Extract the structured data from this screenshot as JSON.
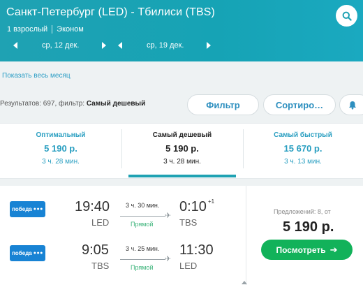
{
  "header": {
    "title": "Санкт-Петербург (LED) - Тбилиси (TBS)",
    "passengers": "1 взрослый",
    "cabin": "Эконом",
    "search_icon": "search-icon",
    "outbound_date": "ср, 12 дек.",
    "return_date": "ср, 19 дек.",
    "colors": {
      "accent": "#1fa2b3"
    }
  },
  "month_link": "Показать весь месяц",
  "results": {
    "prefix": "Результатов: 697, фильтр:",
    "filter": "Самый дешевый"
  },
  "buttons": {
    "filter": "Фильтр",
    "sort": "Сортиро…",
    "bell_icon": "bell-icon"
  },
  "tabs": [
    {
      "title": "Оптимальный",
      "price": "5 190 р.",
      "duration": "3 ч. 28 мин."
    },
    {
      "title": "Самый дешевый",
      "price": "5 190 р.",
      "duration": "3 ч. 28 мин."
    },
    {
      "title": "Самый быстрый",
      "price": "15 670 р.",
      "duration": "3 ч. 13 мин."
    }
  ],
  "result": {
    "airline": "победа",
    "outbound": {
      "dep_time": "19:40",
      "dep_code": "LED",
      "duration": "3 ч. 30 мин.",
      "stops": "Прямой",
      "arr_time": "0:10",
      "arr_code": "TBS",
      "day_offset": "+1"
    },
    "inbound": {
      "dep_time": "9:05",
      "dep_code": "TBS",
      "duration": "3 ч. 25 мин.",
      "stops": "Прямой",
      "arr_time": "11:30",
      "arr_code": "LED"
    },
    "offers": "Предложений: 8, от",
    "price": "5 190 р.",
    "view_button": "Посмотреть",
    "colors": {
      "button": "#12b25a",
      "direct": "#3cb37a"
    }
  }
}
